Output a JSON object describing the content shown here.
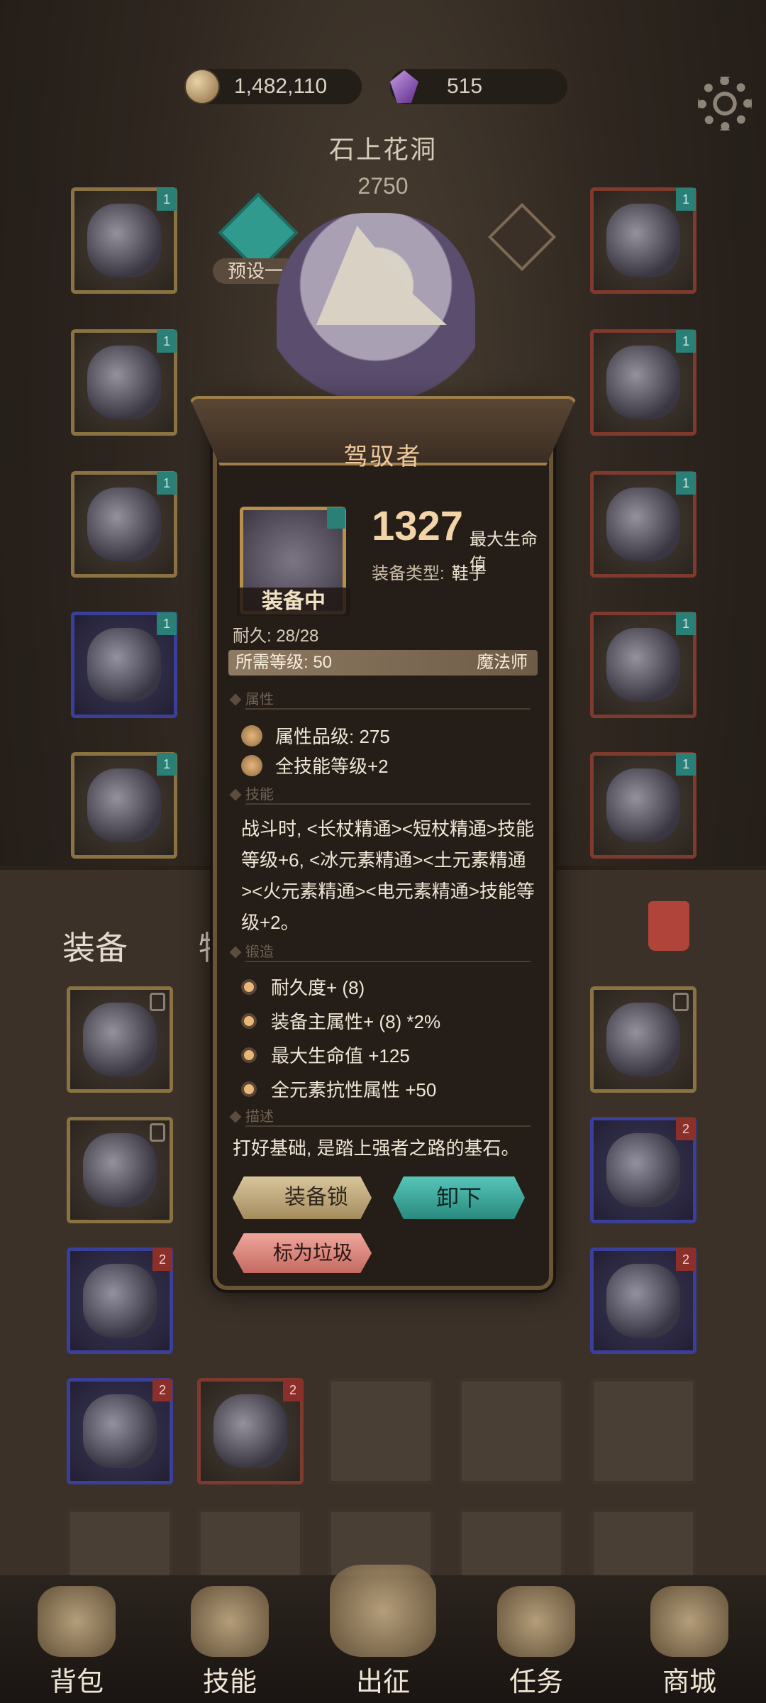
{
  "top": {
    "gold": "1,482,110",
    "gems": "515"
  },
  "area": {
    "name": "石上花洞",
    "score": "2750",
    "preset": "预设一"
  },
  "tabs": {
    "equip": "装备",
    "items": "物品"
  },
  "popup": {
    "title": "驾驭者",
    "badge": "装备中",
    "main_value": "1327",
    "main_stat": "最大生命值",
    "type_label": "装备类型:",
    "type_value": "鞋子",
    "durability": "耐久: 28/28",
    "req_level": "所需等级: 50",
    "req_class": "魔法师",
    "sec_attr": "属性",
    "attr_quality": "属性品级: 275",
    "attr_skill": "全技能等级+2",
    "sec_skill": "技能",
    "skill_text": "战斗时, <长杖精通><短杖精通>技能等级+6, <冰元素精通><土元素精通><火元素精通><电元素精通>技能等级+2。",
    "sec_forge": "锻造",
    "forge": [
      "耐久度+ (8)",
      "装备主属性+ (8) *2%",
      "最大生命值 +125",
      "全元素抗性属性 +50"
    ],
    "sec_desc": "描述",
    "desc": "打好基础, 是踏上强者之路的基石。",
    "btn_lock": "装备锁",
    "btn_unequip": "卸下",
    "btn_junk": "标为垃圾"
  },
  "nav": [
    "背包",
    "技能",
    "出征",
    "任务",
    "商城"
  ],
  "badges": {
    "one": "1",
    "two": "2"
  }
}
